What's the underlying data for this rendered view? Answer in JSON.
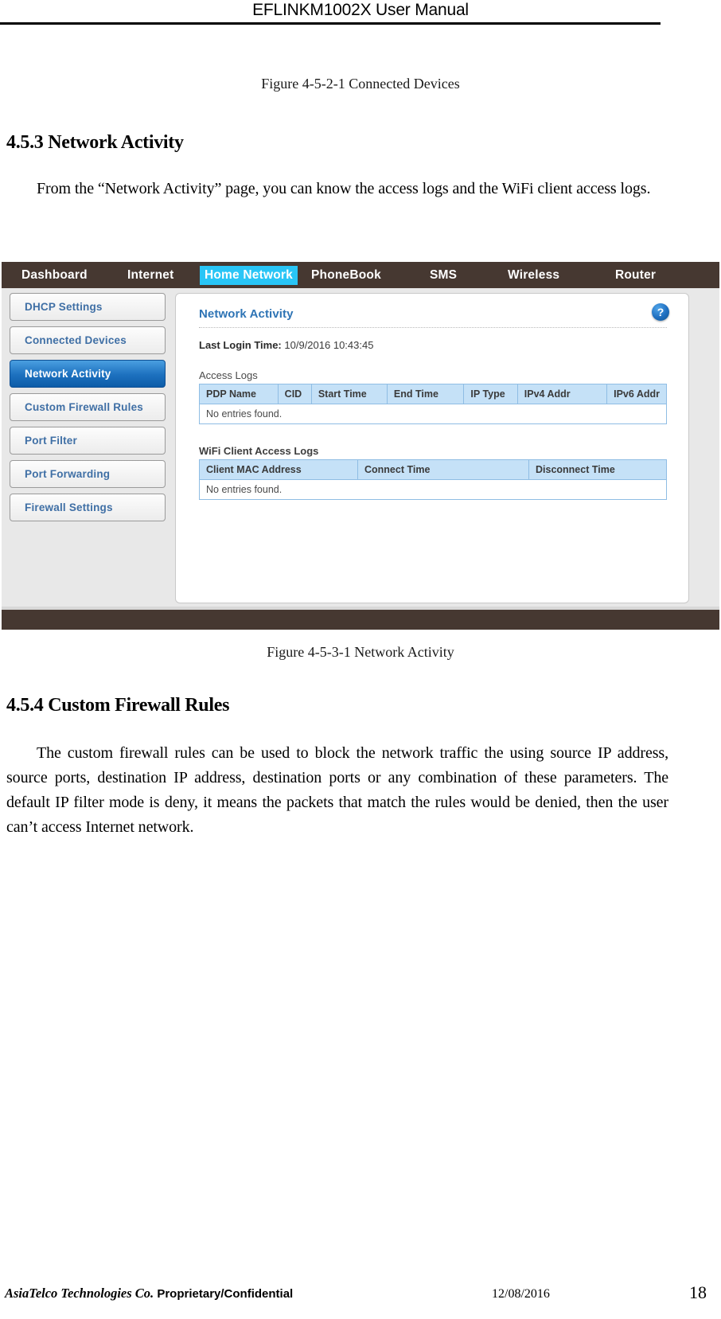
{
  "document": {
    "running_header": "EFLINKM1002X User Manual",
    "figure_caption_top": "Figure 4-5-2-1 Connected Devices",
    "figure_caption_bottom": "Figure 4-5-3-1 Network Activity",
    "section_453_heading": "4.5.3 Network Activity",
    "section_453_paragraph": "From the “Network Activity” page, you can know the access logs and the WiFi client access logs.",
    "section_454_heading": "4.5.4 Custom Firewall Rules",
    "section_454_paragraph": "The custom firewall rules can be used to block the network traffic the using source IP address, source ports, destination IP address, destination ports or any combination of these parameters. The default IP filter mode is deny, it means the packets that match the rules would be denied, then the user can’t access Internet network.",
    "footer": {
      "company": "AsiaTelco Technologies Co.",
      "confidentiality": "Proprietary/Confidential",
      "date": "12/08/2016",
      "page_number": "18"
    }
  },
  "router_ui": {
    "colors": {
      "nav_background": "#463831",
      "nav_active": "#29c5f6",
      "sidebar_active": "#1e72c0",
      "title_blue": "#2e74b5",
      "table_header": "#c5e1f7",
      "table_border": "#8fbde4"
    },
    "nav": {
      "items": [
        {
          "label": "Dashboard",
          "active": false
        },
        {
          "label": "Internet",
          "active": false
        },
        {
          "label": "Home Network",
          "active": true
        },
        {
          "label": "PhoneBook",
          "active": false
        },
        {
          "label": "SMS",
          "active": false
        },
        {
          "label": "Wireless",
          "active": false
        },
        {
          "label": "Router",
          "active": false
        }
      ]
    },
    "sidebar": {
      "items": [
        {
          "label": "DHCP Settings",
          "active": false
        },
        {
          "label": "Connected Devices",
          "active": false
        },
        {
          "label": "Network Activity",
          "active": true
        },
        {
          "label": "Custom Firewall Rules",
          "active": false
        },
        {
          "label": "Port Filter",
          "active": false
        },
        {
          "label": "Port Forwarding",
          "active": false
        },
        {
          "label": "Firewall Settings",
          "active": false
        }
      ]
    },
    "content": {
      "title": "Network Activity",
      "help_icon": "?",
      "last_login_label": "Last Login Time:",
      "last_login_value": "10/9/2016 10:43:45",
      "access_logs": {
        "label": "Access Logs",
        "columns": [
          "PDP Name",
          "CID",
          "Start Time",
          "End Time",
          "IP Type",
          "IPv4 Addr",
          "IPv6 Addr"
        ],
        "empty_message": "No entries found."
      },
      "wifi_client_access_logs": {
        "label": "WiFi Client Access Logs",
        "columns": [
          "Client MAC Address",
          "Connect Time",
          "Disconnect Time"
        ],
        "empty_message": "No entries found."
      }
    }
  }
}
